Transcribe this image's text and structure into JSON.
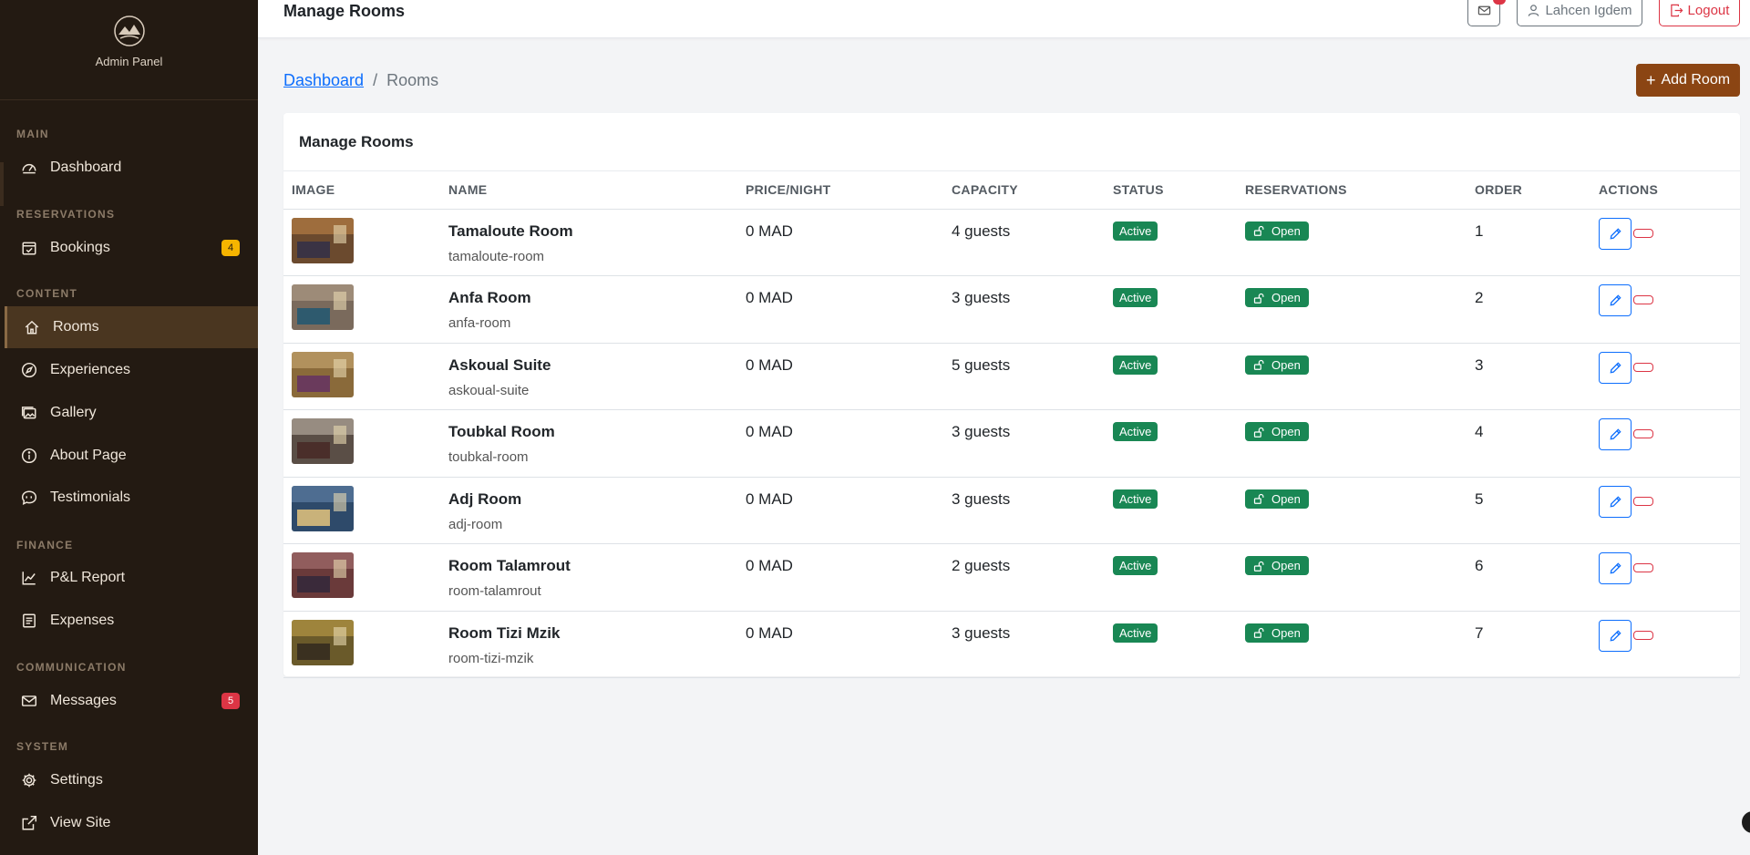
{
  "sidebar": {
    "brand": "Admin Panel",
    "sections": {
      "main": "MAIN",
      "reservations": "RESERVATIONS",
      "content": "CONTENT",
      "finance": "FINANCE",
      "communication": "COMMUNICATION",
      "system": "SYSTEM"
    },
    "items": {
      "dashboard": "Dashboard",
      "bookings": "Bookings",
      "bookings_badge": "4",
      "rooms": "Rooms",
      "experiences": "Experiences",
      "gallery": "Gallery",
      "about": "About Page",
      "testimonials": "Testimonials",
      "pl_report": "P&L Report",
      "expenses": "Expenses",
      "messages": "Messages",
      "messages_badge": "5",
      "settings": "Settings",
      "view_site": "View Site"
    }
  },
  "topbar": {
    "title": "Manage Rooms",
    "user": "Lahcen Igdem",
    "logout": "Logout"
  },
  "breadcrumb": {
    "home": "Dashboard",
    "separator": "/",
    "current": "Rooms"
  },
  "add_button": "Add Room",
  "card": {
    "title": "Manage Rooms",
    "columns": [
      "IMAGE",
      "NAME",
      "PRICE/NIGHT",
      "CAPACITY",
      "STATUS",
      "RESERVATIONS",
      "ORDER",
      "ACTIONS"
    ],
    "rows": [
      {
        "name": "Tamaloute Room",
        "slug": "tamaloute-room",
        "price": "0 MAD",
        "capacity": "4 guests",
        "status": "Active",
        "reservations": "Open",
        "order": "1",
        "img": [
          "#6b4a2e",
          "#c98a4a",
          "#3a3344"
        ]
      },
      {
        "name": "Anfa Room",
        "slug": "anfa-room",
        "price": "0 MAD",
        "capacity": "3 guests",
        "status": "Active",
        "reservations": "Open",
        "order": "2",
        "img": [
          "#7a6a5c",
          "#b9a58f",
          "#2e5a6e"
        ]
      },
      {
        "name": "Askoual Suite",
        "slug": "askoual-suite",
        "price": "0 MAD",
        "capacity": "5 guests",
        "status": "Active",
        "reservations": "Open",
        "order": "3",
        "img": [
          "#8a6a3a",
          "#d2b07a",
          "#6a3a5c"
        ]
      },
      {
        "name": "Toubkal Room",
        "slug": "toubkal-room",
        "price": "0 MAD",
        "capacity": "3 guests",
        "status": "Active",
        "reservations": "Open",
        "order": "4",
        "img": [
          "#5a4e46",
          "#cbbfb2",
          "#4a2e2a"
        ]
      },
      {
        "name": "Adj Room",
        "slug": "adj-room",
        "price": "0 MAD",
        "capacity": "3 guests",
        "status": "Active",
        "reservations": "Open",
        "order": "5",
        "img": [
          "#2e4a6a",
          "#6a8ab0",
          "#c9b27a"
        ]
      },
      {
        "name": "Room Talamrout",
        "slug": "room-talamrout",
        "price": "0 MAD",
        "capacity": "2 guests",
        "status": "Active",
        "reservations": "Open",
        "order": "6",
        "img": [
          "#6a3a3a",
          "#b07a7a",
          "#3a2a3a"
        ]
      },
      {
        "name": "Room Tizi Mzik",
        "slug": "room-tizi-mzik",
        "price": "0 MAD",
        "capacity": "3 guests",
        "status": "Active",
        "reservations": "Open",
        "order": "7",
        "img": [
          "#6a5a2a",
          "#c9a84a",
          "#3a3020"
        ]
      }
    ]
  }
}
